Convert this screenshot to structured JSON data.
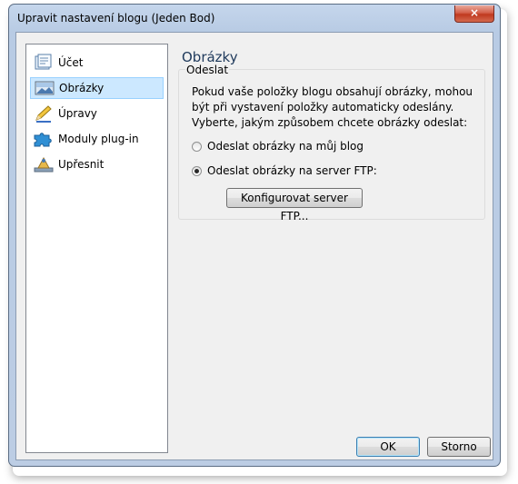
{
  "window": {
    "title": "Upravit nastavení blogu (Jeden Bod)",
    "close_glyph": "×"
  },
  "sidebar": {
    "items": [
      {
        "label": "Účet",
        "icon": "account-icon",
        "selected": false
      },
      {
        "label": "Obrázky",
        "icon": "image-icon",
        "selected": true
      },
      {
        "label": "Úpravy",
        "icon": "pencil-icon",
        "selected": false
      },
      {
        "label": "Moduly plug-in",
        "icon": "puzzle-icon",
        "selected": false
      },
      {
        "label": "Upřesnit",
        "icon": "advanced-icon",
        "selected": false
      }
    ]
  },
  "panel": {
    "title": "Obrázky",
    "group_label": "Odeslat",
    "description": "Pokud vaše položky blogu obsahují obrázky, mohou být při vystavení položky automaticky odeslány. Vyberte, jakým způsobem chcete obrázky odeslat:",
    "options": [
      {
        "label": "Odeslat obrázky na můj blog",
        "checked": false
      },
      {
        "label": "Odeslat obrázky na server FTP:",
        "checked": true
      }
    ],
    "configure_button": "Konfigurovat server FTP..."
  },
  "footer": {
    "ok_label": "OK",
    "cancel_label": "Storno"
  }
}
